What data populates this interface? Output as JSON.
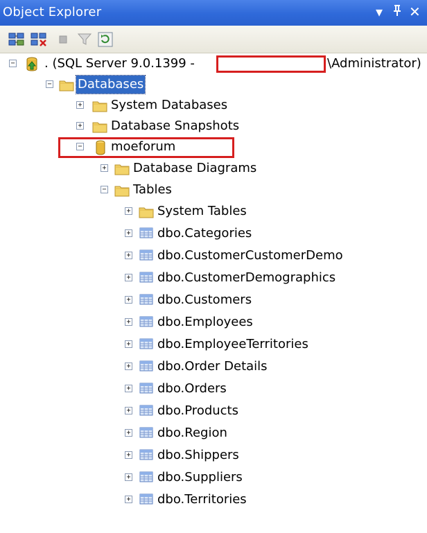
{
  "titlebar": {
    "title": "Object Explorer",
    "dropdown_glyph": "▾",
    "pin_glyph": "ꟾ",
    "close_glyph": "✕",
    "bg_color": "#2f69d9"
  },
  "toolbar": {
    "buttons": [
      {
        "name": "connect-icon",
        "enabled": true
      },
      {
        "name": "disconnect-icon",
        "enabled": true
      },
      {
        "name": "stop-icon",
        "enabled": false
      },
      {
        "name": "filter-icon",
        "enabled": false
      },
      {
        "name": "refresh-icon",
        "enabled": true
      }
    ]
  },
  "tree": {
    "server": {
      "label_prefix": ". (SQL Server 9.0.1399 - ",
      "label_suffix": "\\Administrator)",
      "expander": "−"
    },
    "databases_label": "Databases",
    "system_databases": "System Databases",
    "database_snapshots": "Database Snapshots",
    "database": "moeforum",
    "database_diagrams": "Database Diagrams",
    "tables": "Tables",
    "system_tables": "System Tables",
    "table_items": [
      "dbo.Categories",
      "dbo.CustomerCustomerDemo",
      "dbo.CustomerDemographics",
      "dbo.Customers",
      "dbo.Employees",
      "dbo.EmployeeTerritories",
      "dbo.Order Details",
      "dbo.Orders",
      "dbo.Products",
      "dbo.Region",
      "dbo.Shippers",
      "dbo.Suppliers",
      "dbo.Territories"
    ],
    "expander_plus": "+",
    "expander_minus": "−"
  },
  "colors": {
    "highlight": "#d61f1f",
    "selection": "#316ac5",
    "folder": "#f3d46a",
    "database": "#e8b838"
  }
}
